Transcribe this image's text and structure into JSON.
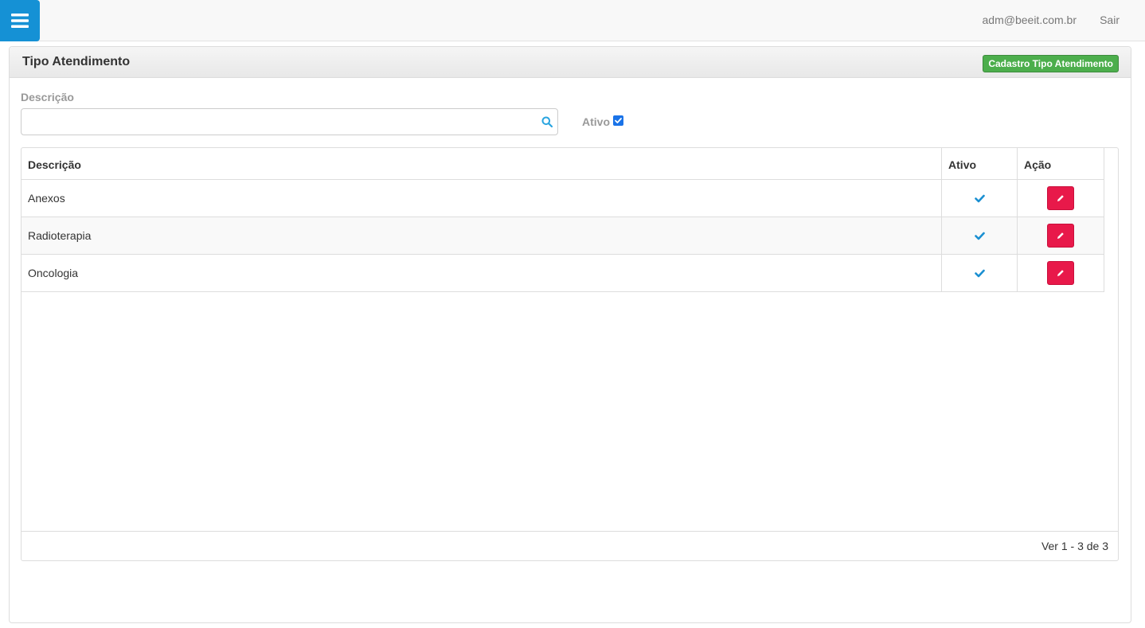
{
  "navbar": {
    "menu_icon": "hamburger-icon",
    "user_email": "adm@beeit.com.br",
    "logout_label": "Sair",
    "accent_color": "#1591d5"
  },
  "panel": {
    "title": "Tipo Atendimento",
    "add_button_label": "Cadastro Tipo Atendimento"
  },
  "filters": {
    "description_label": "Descrição",
    "description_value": "",
    "search_icon": "search-icon",
    "active_label": "Ativo",
    "active_checked": true
  },
  "grid": {
    "columns": [
      "Descrição",
      "Ativo",
      "Ação"
    ],
    "rows": [
      {
        "descricao": "Anexos",
        "ativo": true
      },
      {
        "descricao": "Radioterapia",
        "ativo": true
      },
      {
        "descricao": "Oncologia",
        "ativo": true
      }
    ],
    "pager_info": "Ver 1 - 3 de 3",
    "edit_icon": "pencil-icon",
    "edit_button_color": "#e8194a",
    "check_color": "#1a8fd1"
  }
}
